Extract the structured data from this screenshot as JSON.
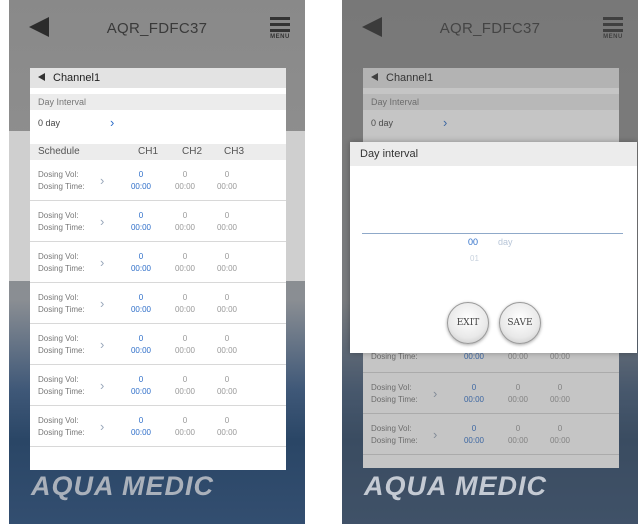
{
  "header": {
    "title": "AQR_FDFC37",
    "menu_label": "MENU"
  },
  "brand": {
    "logo_part1": "AQUA ",
    "logo_part2": "MEDIC"
  },
  "channel": {
    "title": "Channel1",
    "day_interval_label": "Day Interval",
    "day_value": "0 day",
    "schedule_headers": {
      "schedule": "Schedule",
      "ch1": "CH1",
      "ch2": "CH2",
      "ch3": "CH3"
    },
    "dosing_vol_label": "Dosing Vol:",
    "dosing_time_label": "Dosing Time:",
    "rows": [
      {
        "vol": [
          "0",
          "0",
          "0"
        ],
        "time": [
          "00:00",
          "00:00",
          "00:00"
        ]
      },
      {
        "vol": [
          "0",
          "0",
          "0"
        ],
        "time": [
          "00:00",
          "00:00",
          "00:00"
        ]
      },
      {
        "vol": [
          "0",
          "0",
          "0"
        ],
        "time": [
          "00:00",
          "00:00",
          "00:00"
        ]
      },
      {
        "vol": [
          "0",
          "0",
          "0"
        ],
        "time": [
          "00:00",
          "00:00",
          "00:00"
        ]
      },
      {
        "vol": [
          "0",
          "0",
          "0"
        ],
        "time": [
          "00:00",
          "00:00",
          "00:00"
        ]
      },
      {
        "vol": [
          "0",
          "0",
          "0"
        ],
        "time": [
          "00:00",
          "00:00",
          "00:00"
        ]
      },
      {
        "vol": [
          "0",
          "0",
          "0"
        ],
        "time": [
          "00:00",
          "00:00",
          "00:00"
        ]
      }
    ]
  },
  "dialog": {
    "title": "Day interval",
    "selected_value": "00",
    "unit": "day",
    "next_value": "01",
    "exit_label": "EXIT",
    "save_label": "SAVE"
  },
  "colors": {
    "accent": "#2f6fc9"
  }
}
